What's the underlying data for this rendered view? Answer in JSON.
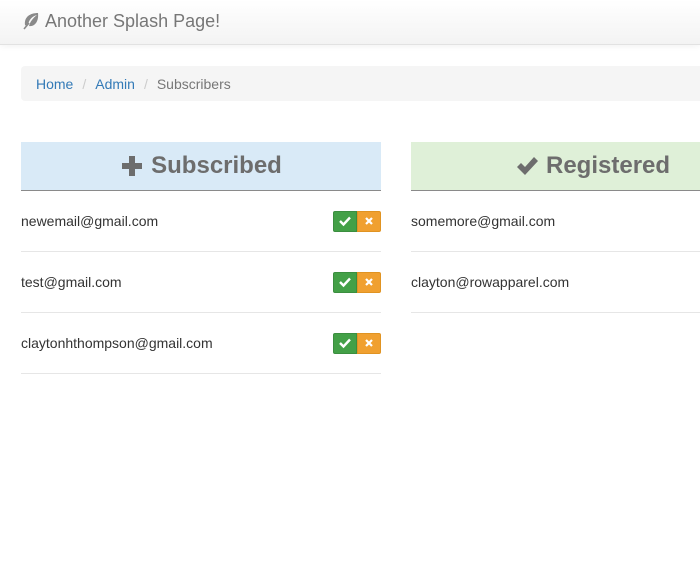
{
  "navbar": {
    "brand": "Another Splash Page!",
    "brand_icon": "leaf-icon"
  },
  "breadcrumb": {
    "items": [
      "Home",
      "Admin"
    ],
    "active": "Subscribers",
    "separator": "/"
  },
  "subscribed": {
    "title": "Subscribed",
    "icon": "plus-icon",
    "color": "#d9eaf7",
    "rows": [
      {
        "email": "newemail@gmail.com"
      },
      {
        "email": "test@gmail.com"
      },
      {
        "email": "claytonhthompson@gmail.com"
      }
    ]
  },
  "registered": {
    "title": "Registered",
    "icon": "check-icon",
    "color": "#dff0d8",
    "rows": [
      {
        "email": "somemore@gmail.com"
      },
      {
        "email": "clayton@rowapparel.com"
      }
    ]
  },
  "actions": {
    "approve_color": "#43a047",
    "reject_color": "#f0a030"
  }
}
